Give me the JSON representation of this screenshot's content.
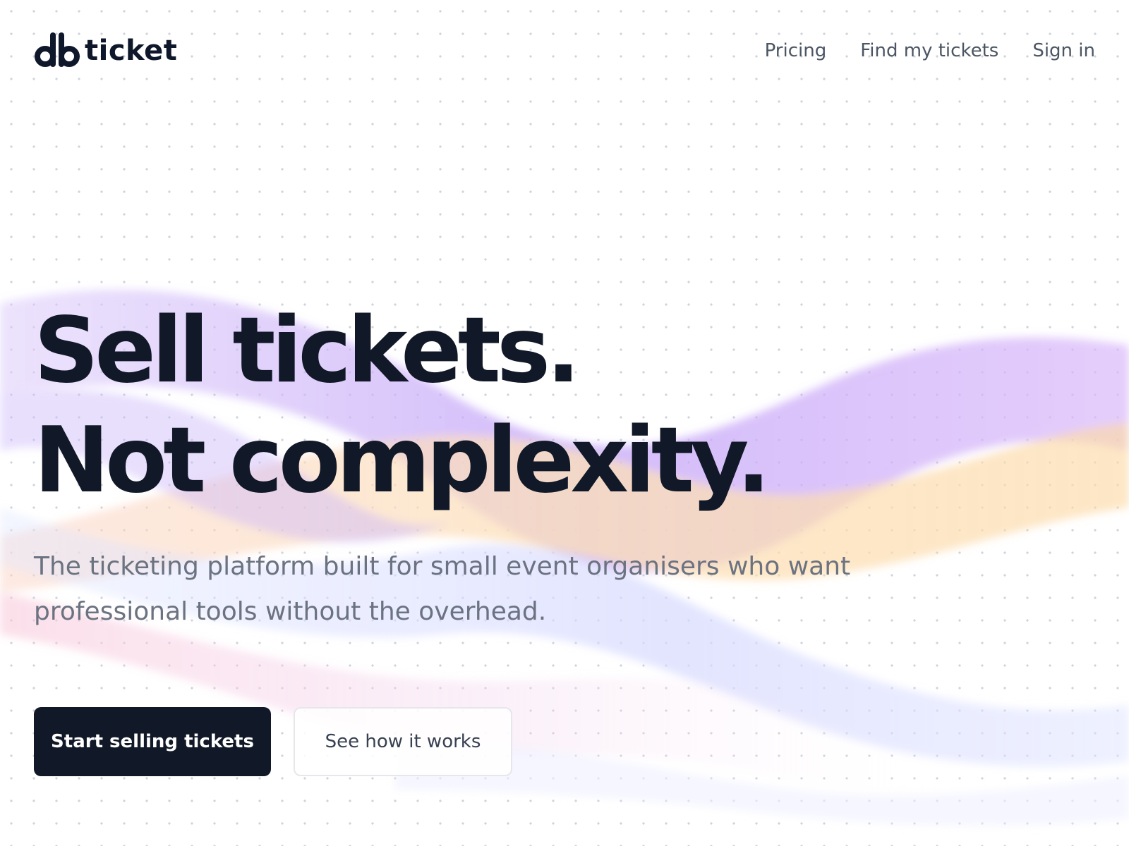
{
  "brand": {
    "logo_icon": "db-monogram-icon",
    "name": "ticket"
  },
  "nav": {
    "items": [
      {
        "label": "Pricing"
      },
      {
        "label": "Find my tickets"
      },
      {
        "label": "Sign in"
      }
    ]
  },
  "hero": {
    "headline_line1": "Sell tickets.",
    "headline_line2": "Not complexity.",
    "subtitle": "The ticketing platform built for small event organisers who want professional tools without the overhead.",
    "primary_cta": "Start selling tickets",
    "secondary_cta": "See how it works"
  },
  "colors": {
    "text_dark": "#111827",
    "text_muted": "#6b7280",
    "nav_text": "#4b5563",
    "wave_purple": "#c4a5f7",
    "wave_orange": "#fdd9a8",
    "wave_pink": "#f7c2d6",
    "wave_blue": "#c7d2fe"
  }
}
